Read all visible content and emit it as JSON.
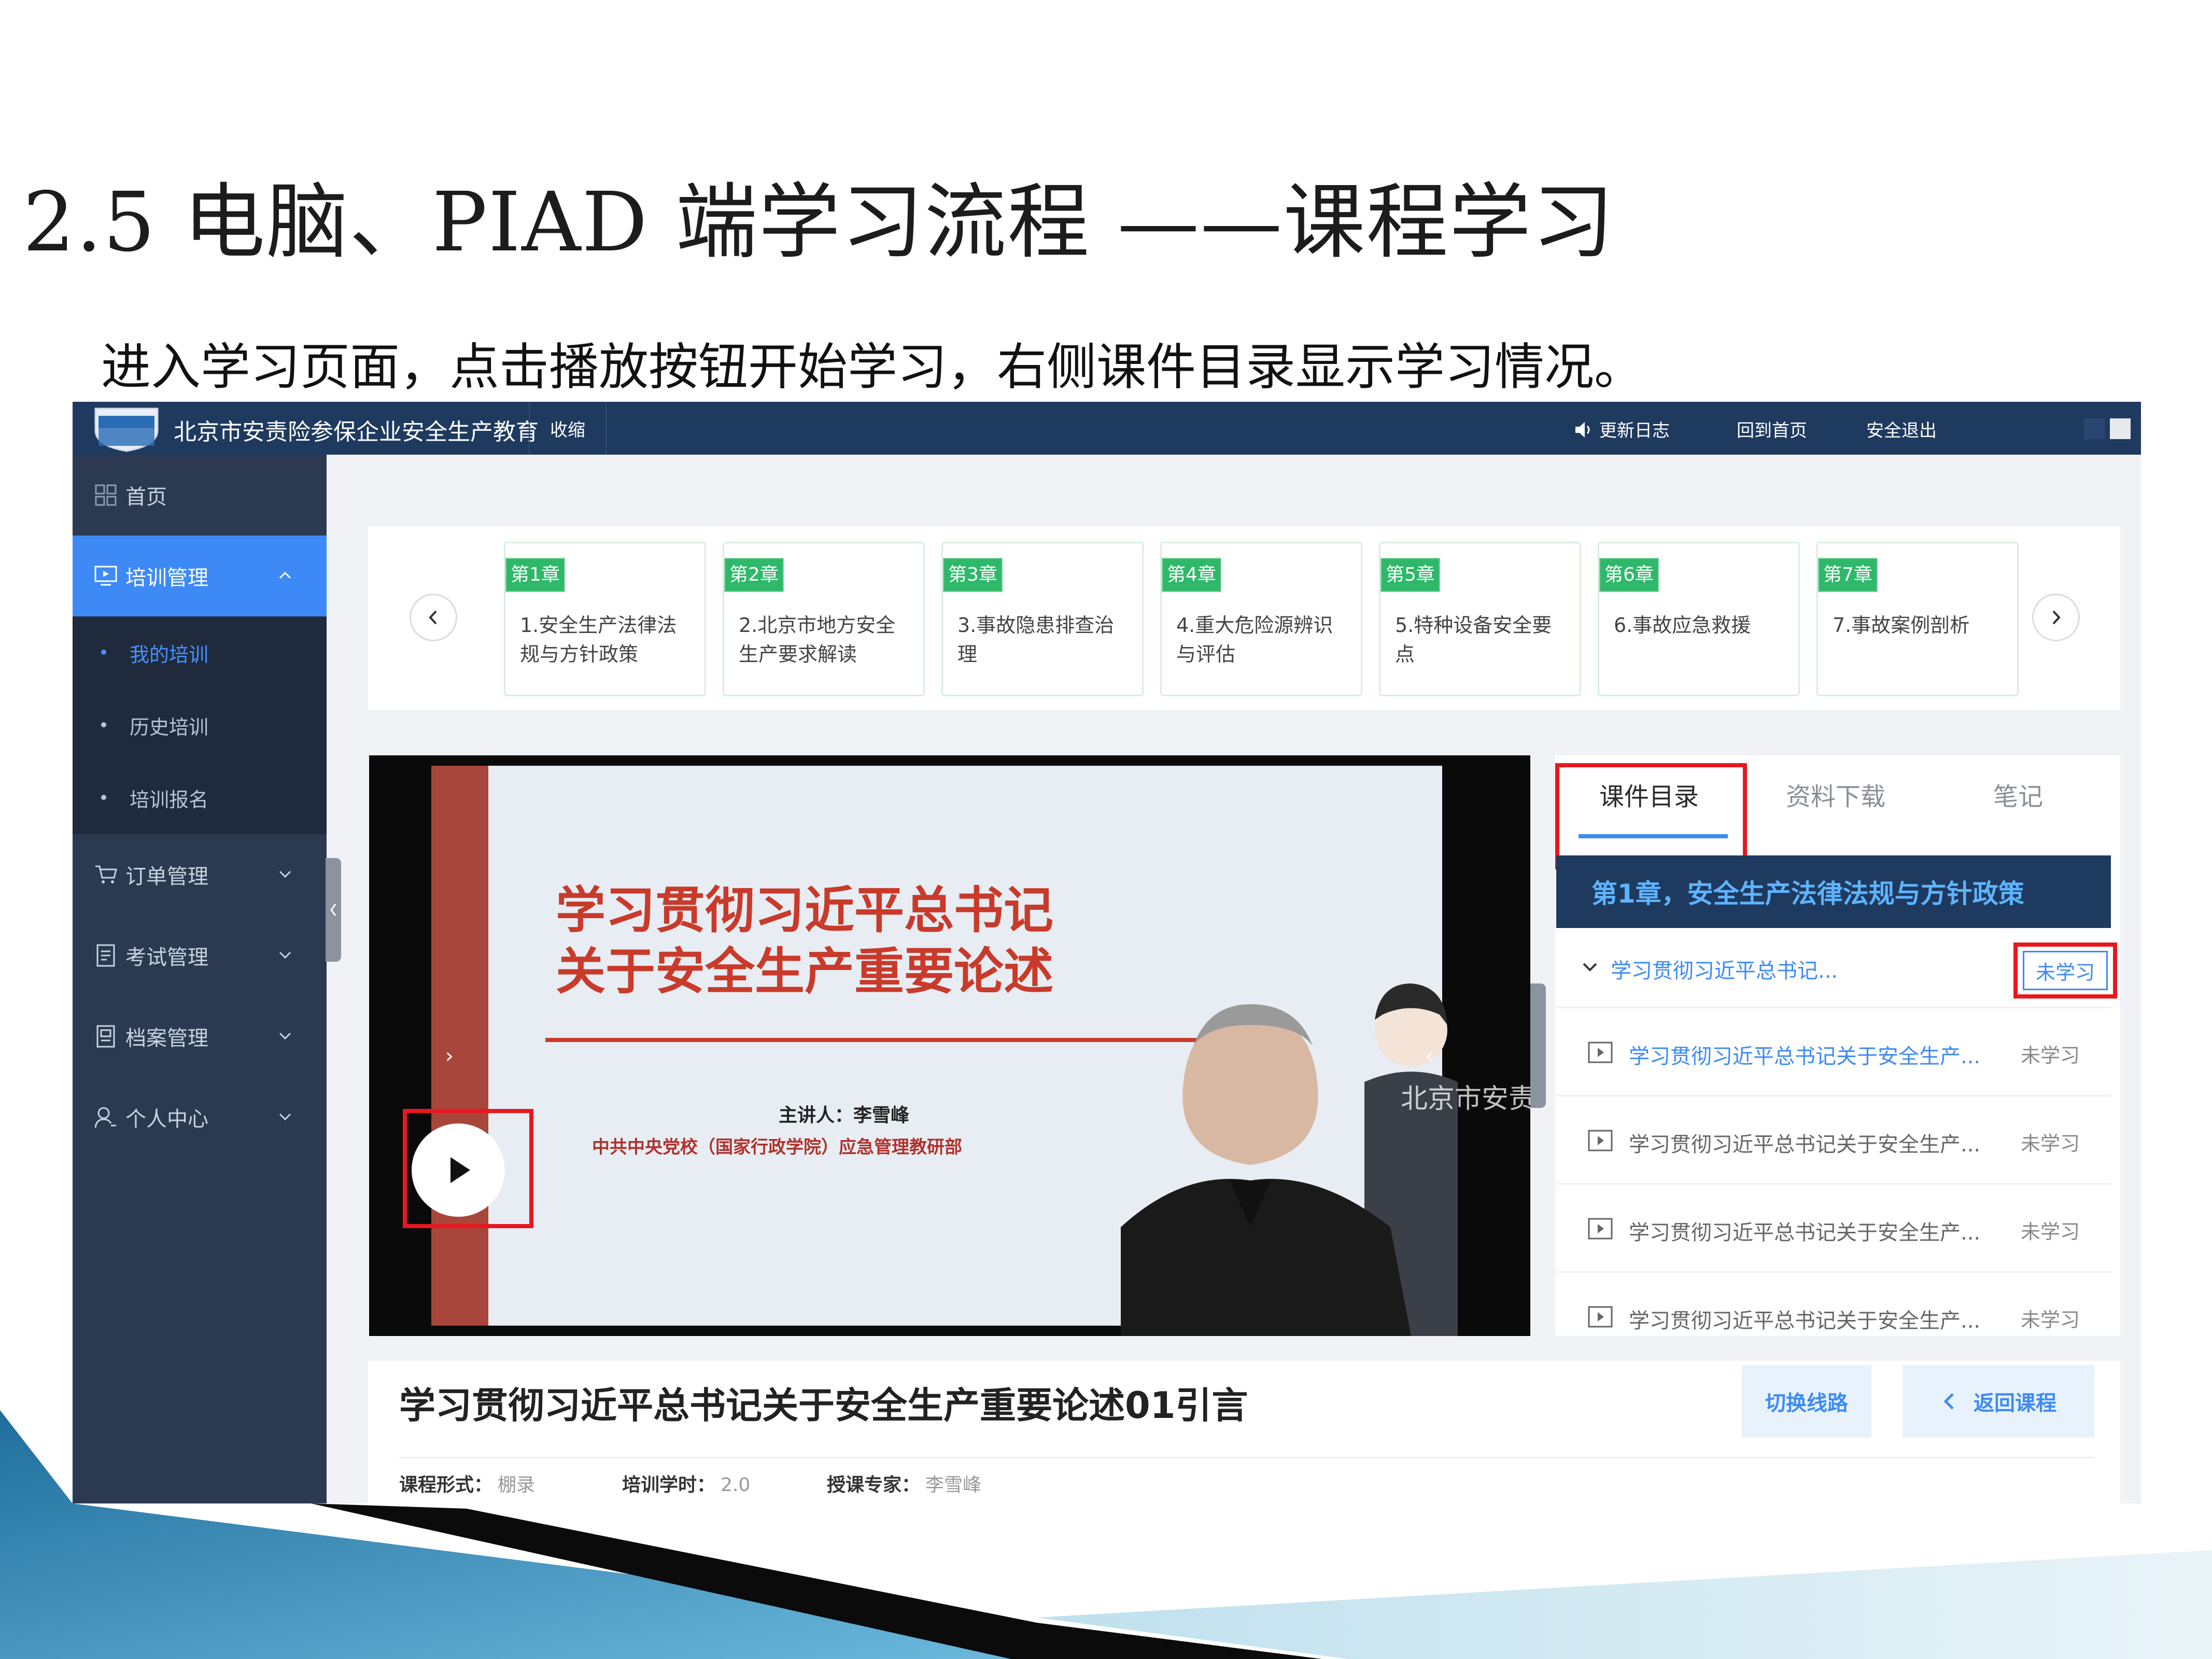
{
  "slide": {
    "title": "2.5 电脑、PIAD 端学习流程 ——课程学习",
    "subtitle": "进入学习页面，点击播放按钮开始学习，右侧课件目录显示学习情况。"
  },
  "app": {
    "title": "北京市安责险参保企业安全生产教育",
    "collapse_label": "收缩",
    "top_links": [
      "更新日志",
      "回到首页",
      "安全退出"
    ],
    "sidebar": {
      "home": "首页",
      "training": "培训管理",
      "training_sub": [
        "我的培训",
        "历史培训",
        "培训报名"
      ],
      "orders": "订单管理",
      "exams": "考试管理",
      "archives": "档案管理",
      "profile": "个人中心"
    },
    "chapters": [
      {
        "tag": "第1章",
        "name": "1.安全生产法律法规与方针政策"
      },
      {
        "tag": "第2章",
        "name": "2.北京市地方安全生产要求解读"
      },
      {
        "tag": "第3章",
        "name": "3.事故隐患排查治理"
      },
      {
        "tag": "第4章",
        "name": "4.重大危险源辨识与评估"
      },
      {
        "tag": "第5章",
        "name": "5.特种设备安全要点"
      },
      {
        "tag": "第6章",
        "name": "6.事故应急救援"
      },
      {
        "tag": "第7章",
        "name": "7.事故案例剖析"
      }
    ],
    "video": {
      "headline_1": "学习贯彻习近平总书记",
      "headline_2": "关于安全生产重要论述",
      "speaker": "主讲人：李雪峰",
      "org": "中共中央党校（国家行政学院）应急管理教研部",
      "watermark": "北京市安责险"
    },
    "panel": {
      "tabs": [
        "课件目录",
        "资料下载",
        "笔记"
      ],
      "chapter_heading": "第1章，安全生产法律法规与方针政策",
      "group": {
        "text": "学习贯彻习近平总书记...",
        "status": "未学习"
      },
      "items": [
        {
          "text": "学习贯彻习近平总书记关于安全生产...",
          "status": "未学习"
        },
        {
          "text": "学习贯彻习近平总书记关于安全生产...",
          "status": "未学习"
        },
        {
          "text": "学习贯彻习近平总书记关于安全生产...",
          "status": "未学习"
        },
        {
          "text": "学习贯彻习近平总书记关于安全生产...",
          "status": "未学习"
        }
      ]
    },
    "course": {
      "title": "学习贯彻习近平总书记关于安全生产重要论述01引言",
      "switch_label": "切换线路",
      "back_label": "返回课程",
      "form_key": "课程形式：",
      "form_val": "棚录",
      "hours_key": "培训学时：",
      "hours_val": "2.0",
      "expert_key": "授课专家：",
      "expert_val": "李雪峰"
    }
  },
  "colors": {
    "topbar": "#1f3a5f",
    "sidebar": "#2b3a51",
    "accent_blue": "#3d8af7",
    "chapter_tag_green": "#2fb86a",
    "highlight_red": "#e8171f"
  },
  "icons": [
    "speaker-icon",
    "grid-icon",
    "monitor-icon",
    "cart-icon",
    "exam-icon",
    "archive-icon",
    "user-icon",
    "play-icon",
    "video-file-icon",
    "chevron-left-icon",
    "chevron-right-icon"
  ]
}
